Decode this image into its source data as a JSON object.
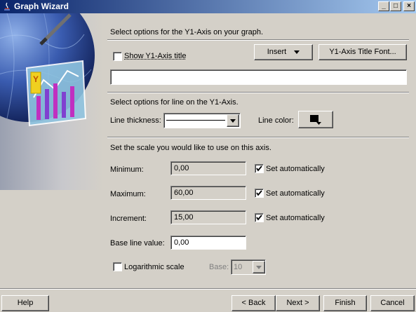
{
  "window": {
    "title": "Graph Wizard",
    "minimize": "_",
    "maximize": "□",
    "close": "×"
  },
  "y1_section": {
    "heading": "Select options for the Y1-Axis on your graph.",
    "show_title_label": "Show Y1-Axis title",
    "show_title_checked": false,
    "insert_label": "Insert",
    "font_button_label": "Y1-Axis Title Font...",
    "title_value": ""
  },
  "line_section": {
    "heading": "Select options for line on the Y1-Axis.",
    "thickness_label": "Line thickness:",
    "color_label": "Line color:",
    "color_value": "#000000"
  },
  "scale_section": {
    "heading": "Set the scale you would like to use on this axis.",
    "minimum_label": "Minimum:",
    "minimum_value": "0,00",
    "maximum_label": "Maximum:",
    "maximum_value": "60,00",
    "increment_label": "Increment:",
    "increment_value": "15,00",
    "set_auto_label": "Set automatically",
    "auto_checked": [
      true,
      true,
      true
    ],
    "baseline_label": "Base line value:",
    "baseline_value": "0,00",
    "log_label": "Logarithmic scale",
    "log_checked": false,
    "base_label": "Base:",
    "base_value": "10"
  },
  "footer": {
    "help": "Help",
    "back": "< Back",
    "next": "Next >",
    "finish": "Finish",
    "cancel": "Cancel"
  },
  "graphic": {
    "axis_letter": "Y"
  }
}
